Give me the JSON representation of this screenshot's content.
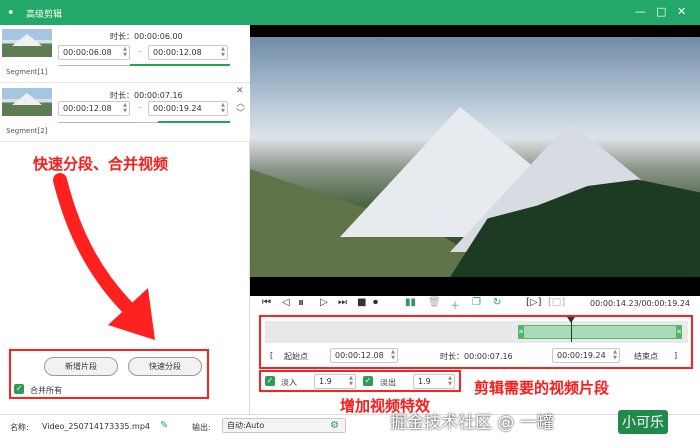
{
  "window": {
    "title": "高级剪辑",
    "logo": "ꔷ",
    "min": "—",
    "max": "□",
    "close": "✕"
  },
  "segments": [
    {
      "label": "Segment[1]",
      "duration_label": "时长：00:00:06.00",
      "start": "00:00:06.08",
      "end": "00:00:12.08"
    },
    {
      "label": "Segment[2]",
      "duration_label": "时长：00:00:07.16",
      "start": "00:00:12.08",
      "end": "00:00:19.24"
    }
  ],
  "dash": "-",
  "left_panel": {
    "add_segment": "新增片段",
    "quick_split": "快速分段",
    "merge_all": "合并所有"
  },
  "annotations": {
    "split_merge": "快速分段、合并视频",
    "clip": "剪辑需要的视频片段",
    "effects": "增加视频特效"
  },
  "player": {
    "time": "00:00:14.23/00:00:19.24"
  },
  "trim": {
    "start_btn": "起始点",
    "start_time": "00:00:12.08",
    "duration_label": "时长：00:00:07.16",
    "end_time": "00:00:19.24",
    "end_btn": "结束点",
    "bracket_left": "[",
    "bracket_right": "]",
    "selection_start": 0.604,
    "selection_end": 1.0
  },
  "effects": {
    "fade_in_label": "淡入",
    "fade_in_value": "1.9",
    "fade_out_label": "淡出",
    "fade_out_value": "1.9"
  },
  "file": {
    "name_label": "名称:",
    "name_value": "Video_250714173335.mp4",
    "output_label": "输出:",
    "output_value": "自动:Auto"
  },
  "watermark": {
    "text": "掘金技术社区 @ 一罐",
    "box": "小可乐"
  },
  "colors": {
    "accent": "#23a86a",
    "annotation": "#ff1a1a"
  }
}
